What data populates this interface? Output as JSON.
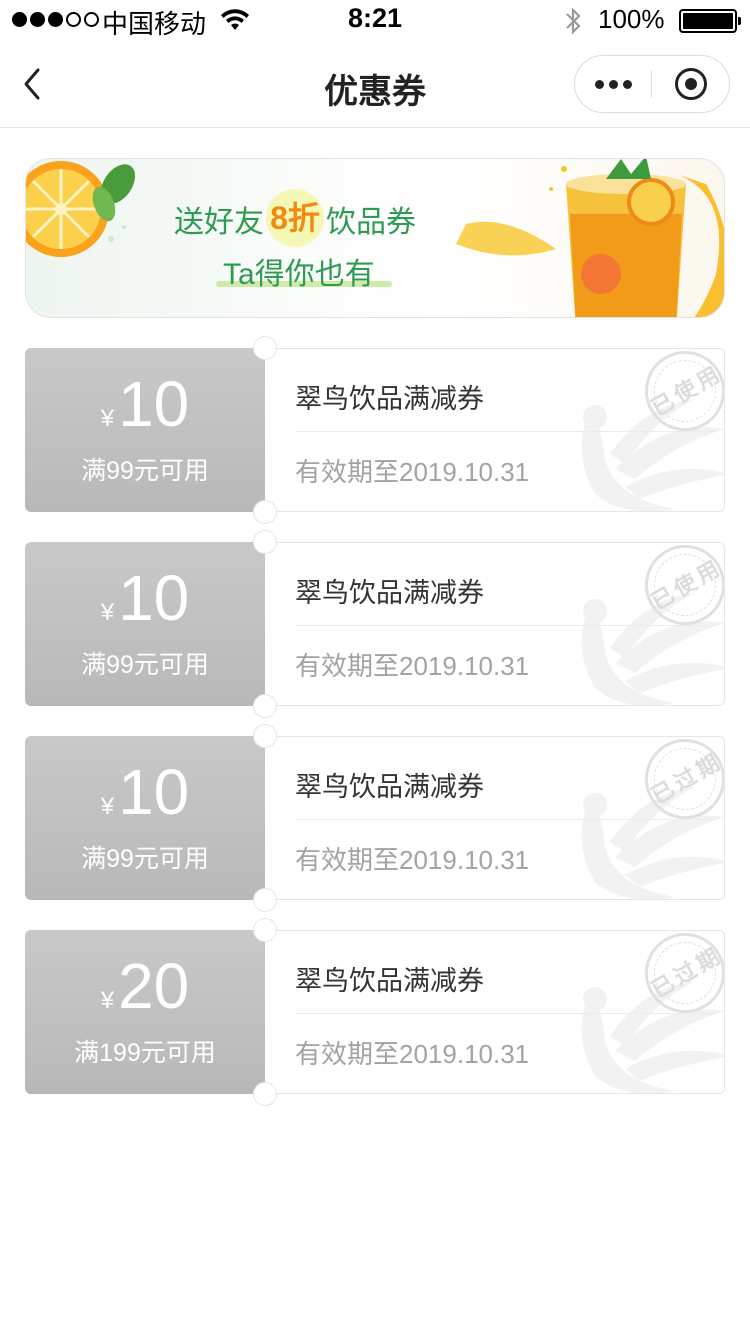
{
  "status_bar": {
    "carrier": "中国移动",
    "time": "8:21",
    "battery_percent": "100%",
    "signal_bars": 3,
    "signal_total": 5,
    "icons": [
      "wifi-icon",
      "bluetooth-icon",
      "battery-icon"
    ]
  },
  "nav": {
    "title": "优惠券",
    "icons": [
      "back-arrow-icon",
      "more-icon",
      "close-target-icon"
    ]
  },
  "banner": {
    "text_before": "送好友",
    "highlight": "8折",
    "text_after": "饮品券",
    "line2": "Ta得你也有",
    "colors": {
      "text": "#2e9a52",
      "highlight": "#f28a12"
    }
  },
  "coupons": [
    {
      "currency": "¥",
      "amount": "10",
      "condition": "满99元可用",
      "name": "翠鸟饮品满减券",
      "validity": "有效期至2019.10.31",
      "stamp": "已使用"
    },
    {
      "currency": "¥",
      "amount": "10",
      "condition": "满99元可用",
      "name": "翠鸟饮品满减券",
      "validity": "有效期至2019.10.31",
      "stamp": "已使用"
    },
    {
      "currency": "¥",
      "amount": "10",
      "condition": "满99元可用",
      "name": "翠鸟饮品满减券",
      "validity": "有效期至2019.10.31",
      "stamp": "已过期"
    },
    {
      "currency": "¥",
      "amount": "20",
      "condition": "满199元可用",
      "name": "翠鸟饮品满减券",
      "validity": "有效期至2019.10.31",
      "stamp": "已过期"
    }
  ]
}
